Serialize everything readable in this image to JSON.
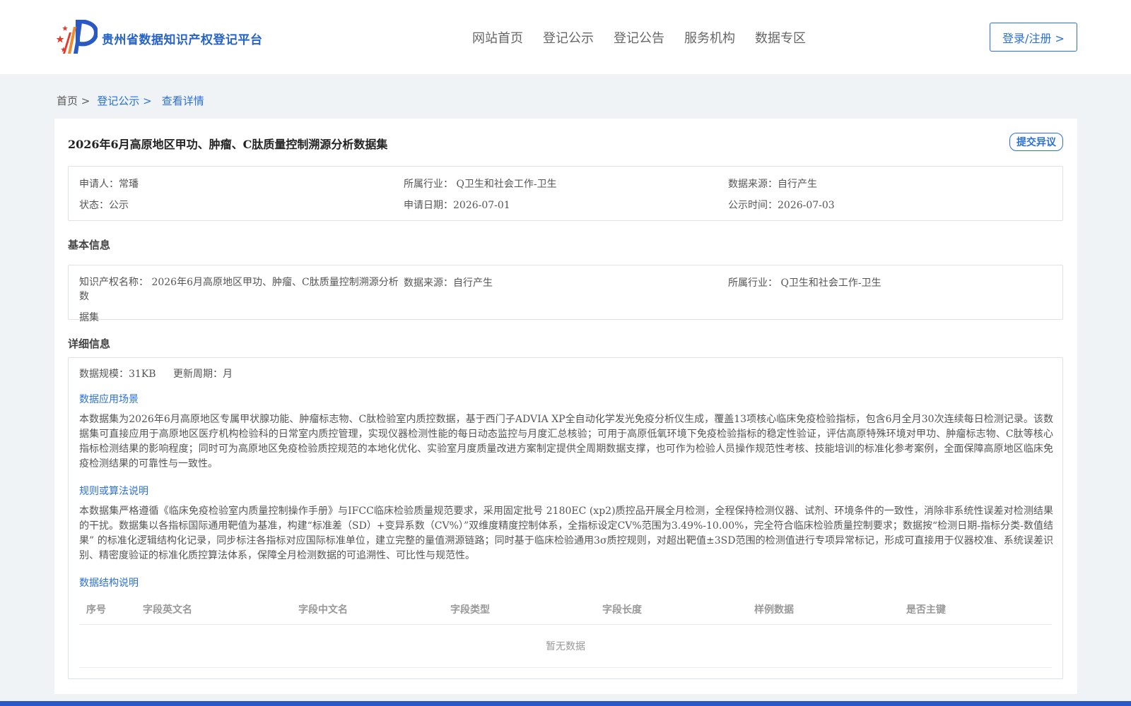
{
  "header": {
    "site_title": "贵州省数据知识产权登记平台",
    "nav": [
      "网站首页",
      "登记公示",
      "登记公告",
      "服务机构",
      "数据专区"
    ],
    "login_label": "登录/注册 >"
  },
  "breadcrumb": {
    "home": "首页 >",
    "section": "登记公示 >",
    "current": "查看详情"
  },
  "detail": {
    "title": "2026年6月高原地区甲功、肿瘤、C肽质量控制溯源分析数据集",
    "objection_label": "提交异议",
    "meta": {
      "applicant": "申请人：常璠",
      "industry": "所属行业： Q卫生和社会工作-卫生",
      "source": "数据来源：自行产生",
      "status": "状态：公示",
      "apply_date": "申请日期：2026-07-01",
      "publish_date": "公示时间：2026-07-03"
    }
  },
  "basic_info": {
    "heading": "基本信息",
    "ip_name_line1": "知识产权名称： 2026年6月高原地区甲功、肿瘤、C肽质量控制溯源分析数",
    "ip_name_line2": "据集",
    "source": "数据来源：自行产生",
    "industry": "所属行业： Q卫生和社会工作-卫生"
  },
  "detail_info": {
    "heading": "详细信息",
    "scale": "数据规模：31KB",
    "update_cycle": "更新周期：月",
    "scenario_heading": "数据应用场景",
    "scenario_text": "本数据集为2026年6月高原地区专属甲状腺功能、肿瘤标志物、C肽检验室内质控数据，基于西门子ADVIA XP全自动化学发光免疫分析仪生成，覆盖13项核心临床免疫检验指标，包含6月全月30次连续每日检测记录。该数据集可直接应用于高原地区医疗机构检验科的日常室内质控管理，实现仪器检测性能的每日动态监控与月度汇总核验；可用于高原低氧环境下免疫检验指标的稳定性验证，评估高原特殊环境对甲功、肿瘤标志物、C肽等核心指标检测结果的影响程度；同时可为高原地区免疫检验质控规范的本地化优化、实验室月度质量改进方案制定提供全周期数据支撑，也可作为检验人员操作规范性考核、技能培训的标准化参考案例，全面保障高原地区临床免疫检测结果的可靠性与一致性。",
    "algorithm_heading": "规则或算法说明",
    "algorithm_text": "本数据集严格遵循《临床免疫检验室内质量控制操作手册》与IFCC临床检验质量规范要求，采用固定批号 2180EC (xp2)质控品开展全月检测，全程保持检测仪器、试剂、环境条件的一致性，消除非系统性误差对检测结果的干扰。数据集以各指标国际通用靶值为基准，构建“标准差（SD）+变异系数（CV%）”双维度精度控制体系，全指标设定CV%范围为3.49%-10.00%，完全符合临床检验质量控制要求；数据按“检测日期-指标分类-数值结果” 的标准化逻辑结构化记录，同步标注各指标对应国际标准单位，建立完整的量值溯源链路；同时基于临床检验通用3σ质控规则，对超出靶值±3SD范围的检测值进行专项异常标记，形成可直接用于仪器校准、系统误差识别、精密度验证的标准化质控算法体系，保障全月检测数据的可追溯性、可比性与规范性。",
    "structure_heading": "数据结构说明",
    "table_headers": [
      "序号",
      "字段英文名",
      "字段中文名",
      "字段类型",
      "字段长度",
      "样例数据",
      "是否主键"
    ],
    "empty_text": "暂无数据"
  },
  "colors": {
    "brand": "#2563c9",
    "accent": "#2b70d6",
    "footer": "#2a58c4",
    "logo_red": "#e23b2e",
    "logo_orange": "#f08a2c"
  }
}
